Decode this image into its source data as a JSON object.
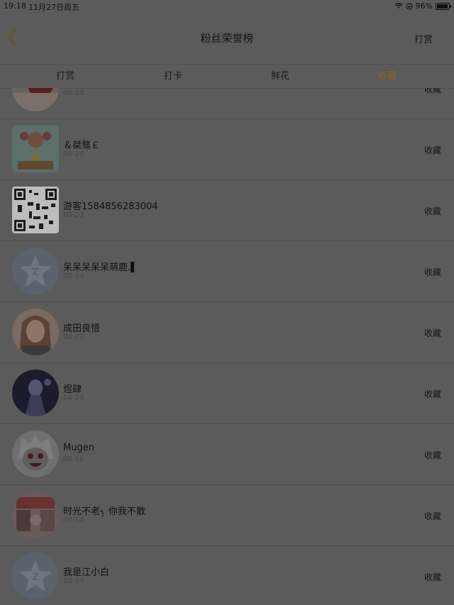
{
  "status_bar": {
    "time": "19:18",
    "date": "11月27日周五",
    "battery_percent": "96%",
    "battery_level": 0.96
  },
  "nav": {
    "title": "粉丝荣誉榜",
    "right_label": "打赏"
  },
  "tabs": [
    {
      "label": "打赏"
    },
    {
      "label": "打卡"
    },
    {
      "label": "鲜花"
    },
    {
      "label": "收藏",
      "active": true
    }
  ],
  "colors": {
    "accent": "#8a6324",
    "overlay_bg": "#5b5b5b"
  },
  "rows": [
    {
      "name": "",
      "date": "08-24",
      "action": "收藏"
    },
    {
      "name": "＆桀骜￡",
      "date": "08-24",
      "action": "收藏"
    },
    {
      "name": "游客1584856283004",
      "date": "08-23",
      "action": "收藏"
    },
    {
      "name": "呆呆呆呆呆萌鹿.▌",
      "date": "08-23",
      "action": "收藏"
    },
    {
      "name": "成田良悟",
      "date": "08-23",
      "action": "收藏"
    },
    {
      "name": "煜肆",
      "date": "08-23",
      "action": "收藏"
    },
    {
      "name": "Mugen",
      "date": "08-16",
      "action": "收藏"
    },
    {
      "name": "时光不老╮ 你我不散",
      "date": "08-14",
      "action": "收藏"
    },
    {
      "name": "我是江小白",
      "date": "08-14",
      "action": "收藏"
    }
  ]
}
